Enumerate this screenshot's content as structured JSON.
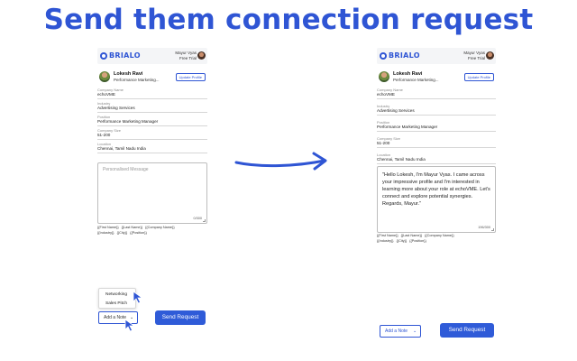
{
  "headline": "Send them connection request",
  "app": {
    "logo_text": "BRIALO",
    "user_name": "Mayur Vyas",
    "plan": "Free Trial"
  },
  "profile": {
    "name": "Lokesh Ravi",
    "title_short": "Performance Marketing...",
    "update_label": "Update Profile"
  },
  "fields": [
    {
      "label": "Company Name",
      "value": "echoVME"
    },
    {
      "label": "Industry",
      "value": "Advertising Services"
    },
    {
      "label": "Position",
      "value": "Performance Marketing Manager"
    },
    {
      "label": "Company Size",
      "value": "51-200"
    },
    {
      "label": "Location",
      "value": "Chennai, Tamil Nadu India"
    }
  ],
  "left": {
    "message_placeholder": "Personalised Message",
    "counter": "0/300",
    "tags_row1": [
      "{{First Name}}",
      "{{Last Name}}",
      "{{Company Name}}"
    ],
    "tags_row2": [
      "{{Industry}}",
      "{{City}}",
      "{{Position}}"
    ],
    "dropdown_items": [
      "Networking",
      "Sales Pitch"
    ],
    "add_note_label": "Add a Note",
    "send_label": "Send Request"
  },
  "right": {
    "message": "\"Hello Lokesh, I'm Mayur Vyas. I came across your impressive profile and I'm interested in learning more about your role at echoVME. Let's connect and explore potential synergies. Regards, Mayur.\"",
    "counter": "196/300",
    "tags_row1": [
      "{{First Name}}",
      "{{Last Name}}",
      "{{Company Name}}"
    ],
    "tags_row2": [
      "{{Industry}}",
      "{{City}}",
      "{{Position}}"
    ],
    "add_note_label": "Add a Note",
    "send_label": "Send Request"
  },
  "colors": {
    "brand": "#2f55d4",
    "button": "#2f5bd8"
  },
  "icons": [
    "cursor-icon",
    "chevron-down-icon",
    "flow-arrow-icon"
  ]
}
